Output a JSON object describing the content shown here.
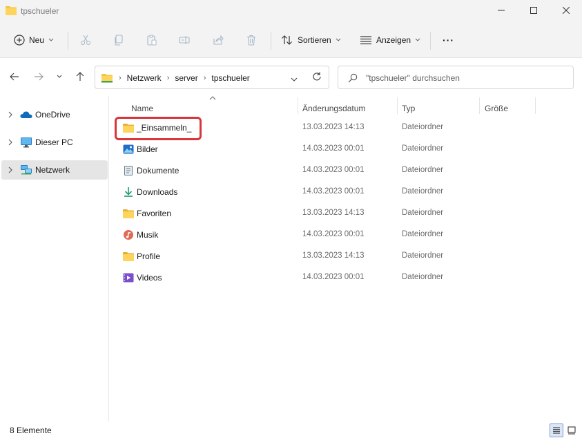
{
  "window": {
    "title": "tpschueler"
  },
  "toolbar": {
    "new_label": "Neu",
    "sort_label": "Sortieren",
    "view_label": "Anzeigen",
    "more_label": "···"
  },
  "address": {
    "crumbs": [
      "Netzwerk",
      "server",
      "tpschueler"
    ]
  },
  "search": {
    "placeholder": "\"tpschueler\" durchsuchen"
  },
  "sidebar": {
    "items": [
      {
        "label": "OneDrive",
        "icon": "cloud-icon"
      },
      {
        "label": "Dieser PC",
        "icon": "monitor-icon"
      },
      {
        "label": "Netzwerk",
        "icon": "network-icon",
        "active": true
      }
    ]
  },
  "columns": {
    "name": "Name",
    "date": "Änderungsdatum",
    "type": "Typ",
    "size": "Größe"
  },
  "files": [
    {
      "name": "_Einsammeln_",
      "date": "13.03.2023 14:13",
      "type": "Dateiordner",
      "icon": "folder-icon"
    },
    {
      "name": "Bilder",
      "date": "14.03.2023 00:01",
      "type": "Dateiordner",
      "icon": "pictures-icon"
    },
    {
      "name": "Dokumente",
      "date": "14.03.2023 00:01",
      "type": "Dateiordner",
      "icon": "documents-icon"
    },
    {
      "name": "Downloads",
      "date": "14.03.2023 00:01",
      "type": "Dateiordner",
      "icon": "downloads-icon"
    },
    {
      "name": "Favoriten",
      "date": "13.03.2023 14:13",
      "type": "Dateiordner",
      "icon": "folder-icon"
    },
    {
      "name": "Musik",
      "date": "14.03.2023 00:01",
      "type": "Dateiordner",
      "icon": "music-icon"
    },
    {
      "name": "Profile",
      "date": "13.03.2023 14:13",
      "type": "Dateiordner",
      "icon": "folder-icon"
    },
    {
      "name": "Videos",
      "date": "14.03.2023 00:01",
      "type": "Dateiordner",
      "icon": "videos-icon"
    }
  ],
  "status": {
    "count": "8 Elemente"
  },
  "colors": {
    "folder": "#f4c542",
    "highlight": "#d9353a",
    "accent": "#0067c0"
  }
}
